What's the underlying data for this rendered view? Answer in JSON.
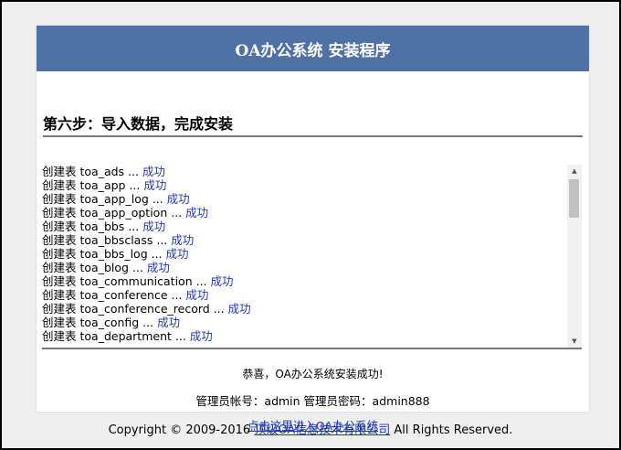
{
  "header": {
    "title": "OA办公系统 安装程序"
  },
  "step": {
    "title": "第六步：导入数据，完成安装"
  },
  "log": {
    "prefix": "创建表",
    "separator": "...",
    "status": "成功",
    "tables": [
      "toa_ads",
      "toa_app",
      "toa_app_log",
      "toa_app_option",
      "toa_bbs",
      "toa_bbsclass",
      "toa_bbs_log",
      "toa_blog",
      "toa_communication",
      "toa_conference",
      "toa_conference_record",
      "toa_config",
      "toa_department"
    ]
  },
  "result": {
    "congrats": "恭喜，OA办公系统安装成功!",
    "credentials": "管理员帐号：admin 管理员密码：admin888",
    "enter_link": "点击这里进入OA办公系统"
  },
  "footer": {
    "prefix": "Copyright © 2009-2016",
    "company": "顶级OA信息技术有限公司",
    "suffix": "All Rights Reserved."
  },
  "colors": {
    "header_bg": "#4f71a6",
    "link": "#1f3ab0"
  }
}
